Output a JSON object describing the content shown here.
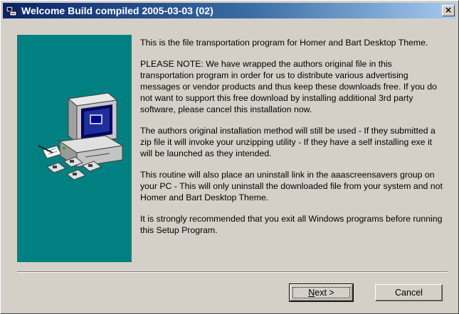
{
  "window": {
    "title": "Welcome Build compiled 2005-03-03 (02)",
    "close_label": "×"
  },
  "content": {
    "paragraphs": [
      "This is the file transportation program for Homer and Bart Desktop Theme.",
      "PLEASE NOTE: We have wrapped the authors original file in this transportation program in order for us to distribute various advertising messages or vendor products and thus keep these downloads free. If you do not want to support this free download by installing additional 3rd party software, please cancel this installation now.",
      "The authors original installation method will still be used - If they submitted a zip file it will invoke your unzipping utility - If they have a self installing exe it will be launched as they intended.",
      "This routine will also place an uninstall link in the aaascreensavers group on your PC - This will only uninstall the downloaded file from your system and not Homer and Bart Desktop Theme.",
      "It is strongly recommended that you exit all Windows programs before running this Setup Program."
    ]
  },
  "buttons": {
    "next_label_underlined": "N",
    "next_label_rest": "ext >",
    "cancel_label": "Cancel"
  },
  "icons": {
    "app": "setup-app-icon",
    "illustration": "computer-with-disks-illustration"
  },
  "colors": {
    "side_panel": "#008080",
    "title_start": "#0a246a",
    "title_end": "#a6caf0"
  }
}
